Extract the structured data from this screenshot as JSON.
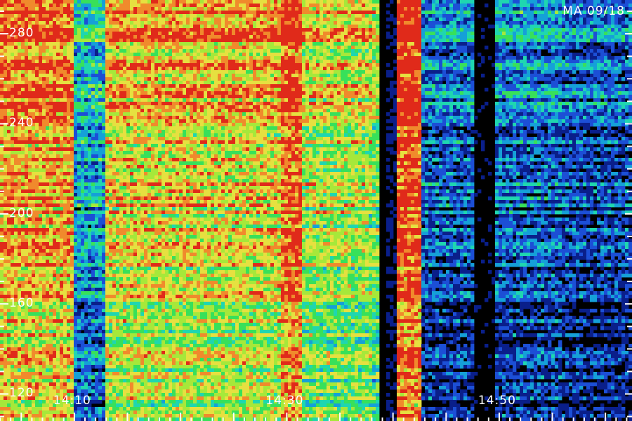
{
  "chart_data": {
    "type": "heatmap",
    "title": "MA 09/18",
    "y_tick_labels": [
      "280",
      "240",
      "200",
      "160",
      "120"
    ],
    "y_ticks": [
      280,
      240,
      200,
      160,
      120
    ],
    "ylim": [
      108,
      295
    ],
    "x_tick_labels": [
      "14:10",
      "14:30",
      "14:50"
    ],
    "x_ticks_min": [
      850,
      870,
      890
    ],
    "xlim_min": [
      843,
      902.5
    ],
    "colors": [
      "#000000",
      "#0a1f8a",
      "#1c4fd6",
      "#15a0d8",
      "#1fd6b0",
      "#38e05a",
      "#a6e83a",
      "#e6e040",
      "#f08a2c",
      "#e02a1a"
    ],
    "intensity_profile": [
      {
        "from": 843.0,
        "to": 850.0,
        "level": 0.78
      },
      {
        "from": 850.0,
        "to": 853.0,
        "level": 0.32
      },
      {
        "from": 853.0,
        "to": 869.5,
        "level": 0.7
      },
      {
        "from": 869.5,
        "to": 871.5,
        "level": 0.86
      },
      {
        "from": 871.5,
        "to": 878.0,
        "level": 0.62
      },
      {
        "from": 878.0,
        "to": 878.8,
        "level": 0.55
      },
      {
        "from": 878.8,
        "to": 879.5,
        "level": 0.04
      },
      {
        "from": 879.5,
        "to": 880.5,
        "level": 0.1
      },
      {
        "from": 880.5,
        "to": 882.8,
        "level": 0.9
      },
      {
        "from": 882.8,
        "to": 887.5,
        "level": 0.2
      },
      {
        "from": 887.5,
        "to": 889.5,
        "level": 0.05
      },
      {
        "from": 889.5,
        "to": 896.0,
        "level": 0.22
      },
      {
        "from": 896.0,
        "to": 902.5,
        "level": 0.17
      }
    ]
  }
}
